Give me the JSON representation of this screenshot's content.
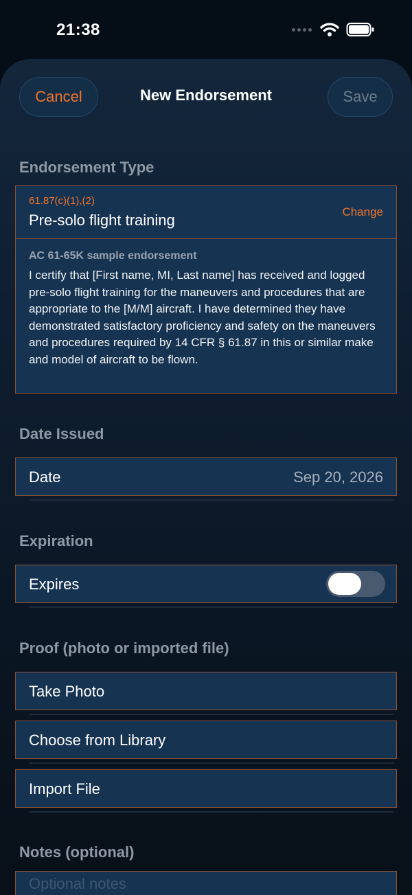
{
  "status_bar": {
    "time": "21:38"
  },
  "nav": {
    "cancel_label": "Cancel",
    "title": "New Endorsement",
    "save_label": "Save"
  },
  "endorsement_type": {
    "section_label": "Endorsement Type",
    "code": "61.87(c)(1),(2)",
    "name": "Pre-solo flight training",
    "change_label": "Change",
    "sample_heading": "AC 61-65K sample endorsement",
    "sample_text": "I certify that [First name, MI, Last name] has received and logged pre-solo flight training for the maneuvers and procedures that are appropriate to the [M/M] aircraft. I have determined they have demonstrated satisfactory proficiency and safety on the maneuvers and procedures required by 14 CFR § 61.87 in this or similar make and model of aircraft to be flown."
  },
  "date_issued": {
    "section_label": "Date Issued",
    "row_label": "Date",
    "value": "Sep 20, 2026"
  },
  "expiration": {
    "section_label": "Expiration",
    "row_label": "Expires",
    "toggle_on": false
  },
  "proof": {
    "section_label": "Proof (photo or imported file)",
    "take_photo_label": "Take Photo",
    "library_label": "Choose from Library",
    "import_label": "Import File"
  },
  "notes": {
    "section_label": "Notes (optional)",
    "placeholder": "Optional notes"
  },
  "colors": {
    "accent": "#f0742b",
    "card": "#163352",
    "card_border": "#8a5234",
    "background": "#050d16"
  }
}
